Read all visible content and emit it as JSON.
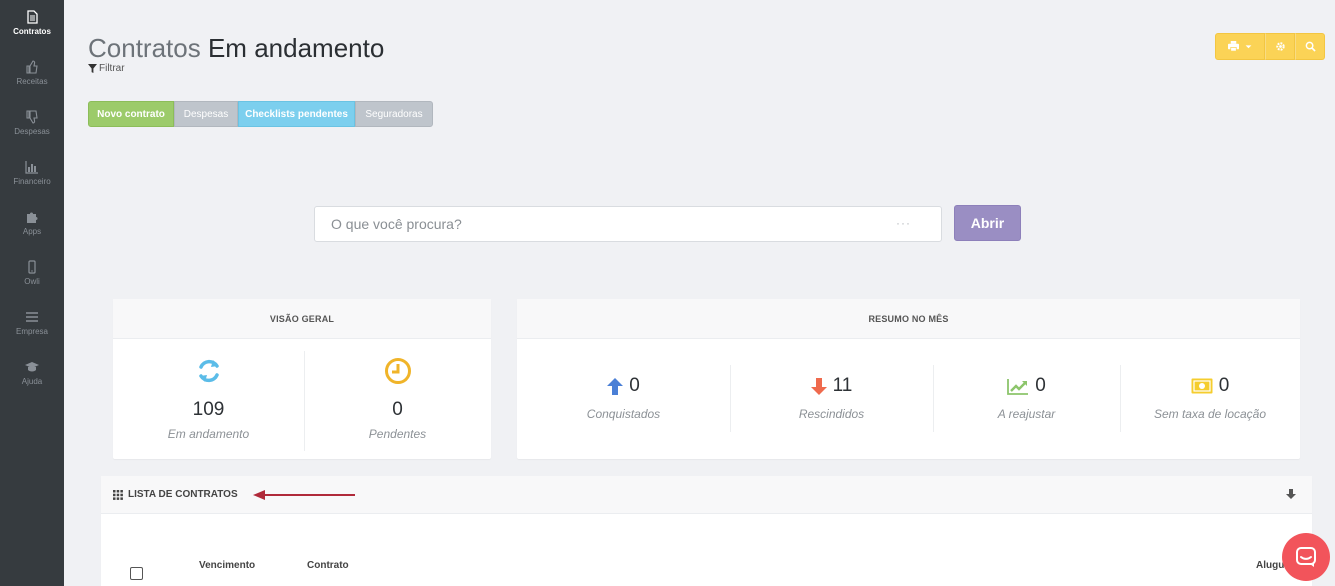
{
  "sidebar": {
    "items": [
      {
        "label": "Contratos",
        "icon": "document-icon",
        "active": true
      },
      {
        "label": "Receitas",
        "icon": "thumbs-up-icon"
      },
      {
        "label": "Despesas",
        "icon": "thumbs-down-icon"
      },
      {
        "label": "Financeiro",
        "icon": "bar-chart-icon"
      },
      {
        "label": "Apps",
        "icon": "puzzle-icon"
      },
      {
        "label": "Owli",
        "icon": "mobile-icon"
      },
      {
        "label": "Empresa",
        "icon": "menu-icon"
      },
      {
        "label": "Ajuda",
        "icon": "graduation-cap-icon"
      }
    ]
  },
  "header": {
    "title_part1": "Contratos",
    "title_part2": "Em andamento",
    "filter_label": "Filtrar"
  },
  "tabs": {
    "novo": "Novo contrato",
    "despesas": "Despesas",
    "checklists": "Checklists pendentes",
    "seguradoras": "Seguradoras"
  },
  "search": {
    "placeholder": "O que você procura?",
    "dots": "···",
    "button": "Abrir"
  },
  "visao_geral": {
    "title": "VISÃO GERAL",
    "stats": [
      {
        "value": "109",
        "caption": "Em andamento"
      },
      {
        "value": "0",
        "caption": "Pendentes"
      }
    ]
  },
  "resumo": {
    "title": "RESUMO NO MÊS",
    "stats": [
      {
        "value": "0",
        "caption": "Conquistados"
      },
      {
        "value": "11",
        "caption": "Rescindidos"
      },
      {
        "value": "0",
        "caption": "A reajustar"
      },
      {
        "value": "0",
        "caption": "Sem taxa de locação"
      }
    ]
  },
  "lista": {
    "title": "LISTA DE CONTRATOS",
    "columns": [
      "Vencimento",
      "Contrato",
      "Alugu"
    ]
  },
  "colors": {
    "sidebar": "#363b3f",
    "accent_yellow": "#fbd356",
    "green": "#9ccb6a",
    "blue": "#7ccfee",
    "purple": "#9a8ec3",
    "chat": "#f2545b"
  }
}
